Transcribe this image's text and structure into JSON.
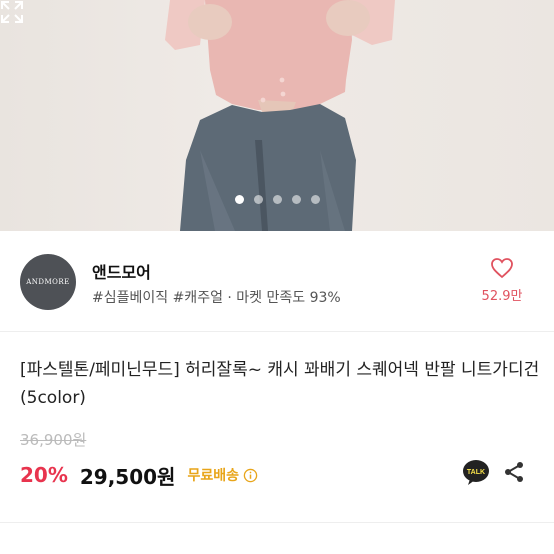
{
  "carousel": {
    "count": 5,
    "active": 0
  },
  "shop": {
    "logo_text": "ANDMORE",
    "name": "앤드모어",
    "tags": "#심플베이직 #캐주얼 · 마켓 만족도 93%",
    "likes": "52.9만"
  },
  "product": {
    "title": "[파스텔톤/페미닌무드] 허리잘록~ 캐시 꽈배기 스퀘어넥 반팔 니트가디건 (5color)",
    "original_price": "36,900원",
    "discount": "20%",
    "price": "29,500원",
    "shipping": "무료배송",
    "talk_label": "TALK"
  },
  "colors": {
    "accent_red": "#e8344e",
    "shipping_orange": "#e8a51a"
  },
  "icons": [
    "expand-icon",
    "heart-icon",
    "info-icon",
    "kakao-talk-icon",
    "share-icon"
  ]
}
